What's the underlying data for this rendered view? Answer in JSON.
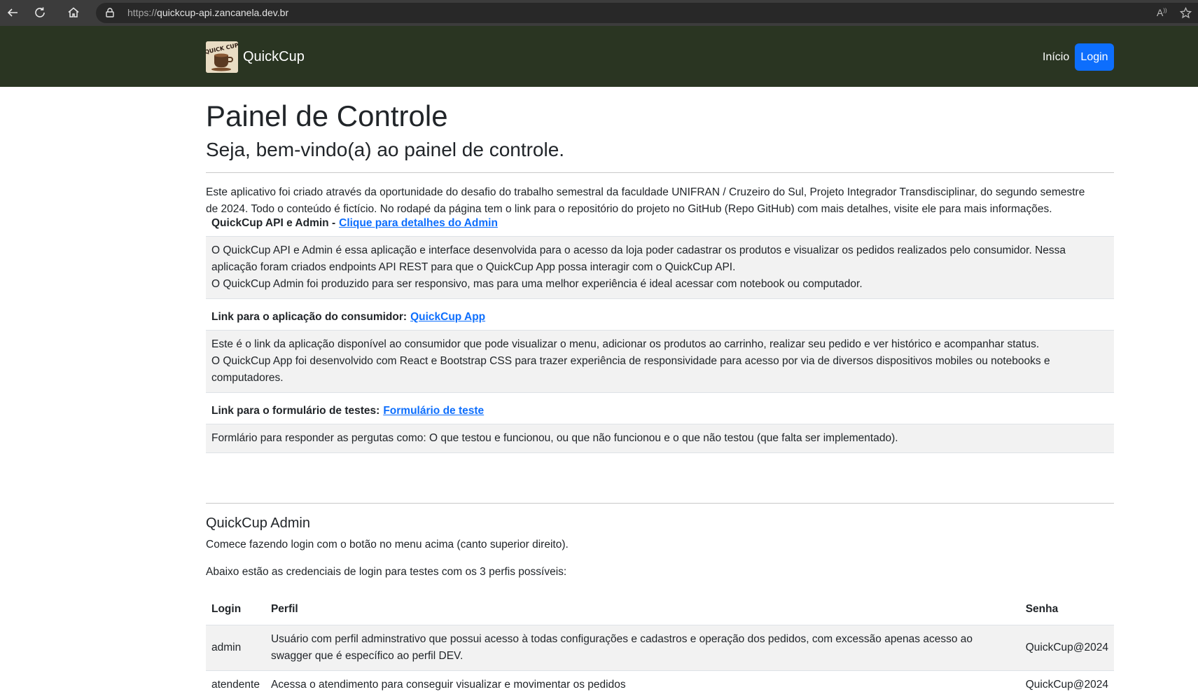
{
  "browser": {
    "url_prefix": "https://",
    "url_host": "quickcup-api.zancanela.dev.br",
    "read_aloud_label": "A",
    "icons": [
      "back-icon",
      "reload-icon",
      "home-icon",
      "lock-icon",
      "read-aloud-icon",
      "favorite-star-icon"
    ]
  },
  "navbar": {
    "brand": "QuickCup",
    "logo_text": "QUICK CUP",
    "links": {
      "inicio": "Início",
      "login": "Login"
    },
    "background": "#2a3522",
    "login_color": "#0d6efd"
  },
  "page": {
    "title": "Painel de Controle",
    "subtitle": "Seja, bem-vindo(a) ao painel de controle.",
    "intro_line1": "Este aplicativo foi criado através da oportunidade do desafio do trabalho semestral da faculdade UNIFRAN / Cruzeiro do Sul, Projeto Integrador Transdisciplinar, do segundo semestre",
    "intro_line2": "de 2024. Todo o conteúdo é fictício. No rodapé da página tem o link para o repositório do projeto no GitHub (Repo GitHub) com mais detalhes, visite ele para mais informações."
  },
  "sections": [
    {
      "heading": "QuickCup API e Admin -",
      "link": "Clique para detalhes do Admin",
      "lines": [
        "O QuickCup API e Admin é essa aplicação e interface desenvolvida para o acesso da loja poder cadastrar os produtos e visualizar os pedidos realizados pelo consumidor. Nessa",
        "aplicação foram criados endpoints API REST para que o QuickCup App possa interagir com o QuickCup API.",
        "O QuickCup Admin foi produzido para ser responsivo, mas para uma melhor experiência é ideal acessar com notebook ou computador."
      ]
    },
    {
      "heading": "Link para o aplicação do consumidor:",
      "link": "QuickCup App",
      "lines": [
        "Este é o link da aplicação disponível ao consumidor que pode visualizar o menu, adicionar os produtos ao carrinho, realizar seu pedido e ver histórico e acompanhar status.",
        "O QuickCup App foi desenvolvido com React e Bootstrap CSS para trazer experiência de responsividade para acesso por via de diversos dispositivos mobiles ou notebooks e",
        "computadores."
      ]
    },
    {
      "heading": "Link para o formulário de testes:",
      "link": "Formulário de teste",
      "lines": [
        "Formlário para responder as pergutas como: O que testou e funcionou, ou que não funcionou e o que não testou (que falta ser implementado)."
      ]
    }
  ],
  "admin": {
    "title": "QuickCup Admin",
    "p1": "Comece fazendo login com o botão no menu acima (canto superior direito).",
    "p2": "Abaixo estão as credenciais de login para testes com os 3 perfis possíveis:",
    "table": {
      "headers": [
        "Login",
        "Perfil",
        "Senha"
      ],
      "rows": [
        {
          "login": "admin",
          "perfil_line1": "Usuário com perfil adminstrativo que possui acesso à todas configurações e cadastros e operação dos pedidos, com excessão apenas acesso ao",
          "perfil_line2": "swagger que é específico ao perfil DEV.",
          "senha": "QuickCup@2024"
        },
        {
          "login": "atendente",
          "perfil_line1": "Acessa o atendimento para conseguir visualizar e movimentar os pedidos",
          "perfil_line2": "",
          "senha": "QuickCup@2024"
        }
      ]
    }
  }
}
